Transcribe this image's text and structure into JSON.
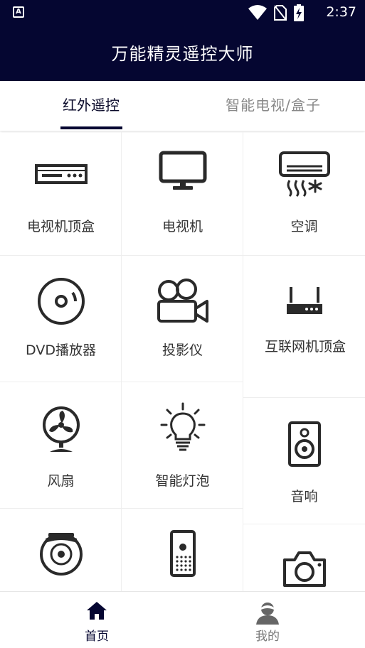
{
  "status_bar": {
    "time": "2:37",
    "left_icon_letter": "A"
  },
  "app_bar": {
    "title": "万能精灵遥控大师"
  },
  "tabs": [
    {
      "label": "红外遥控",
      "active": true
    },
    {
      "label": "智能电视/盒子",
      "active": false
    }
  ],
  "devices": {
    "set_top_box": "电视机顶盒",
    "tv": "电视机",
    "ac": "空调",
    "dvd": "DVD播放器",
    "projector": "投影仪",
    "iptv_box": "互联网机顶盒",
    "fan": "风扇",
    "smart_bulb": "智能灯泡",
    "speaker": "音响",
    "robot_vacuum": "",
    "air_purifier": "",
    "camera": ""
  },
  "bottom_nav": {
    "home": "首页",
    "mine": "我的"
  },
  "colors": {
    "primary": "#050631",
    "icon": "#2a2a2a",
    "text": "#333333",
    "muted": "#888888"
  }
}
